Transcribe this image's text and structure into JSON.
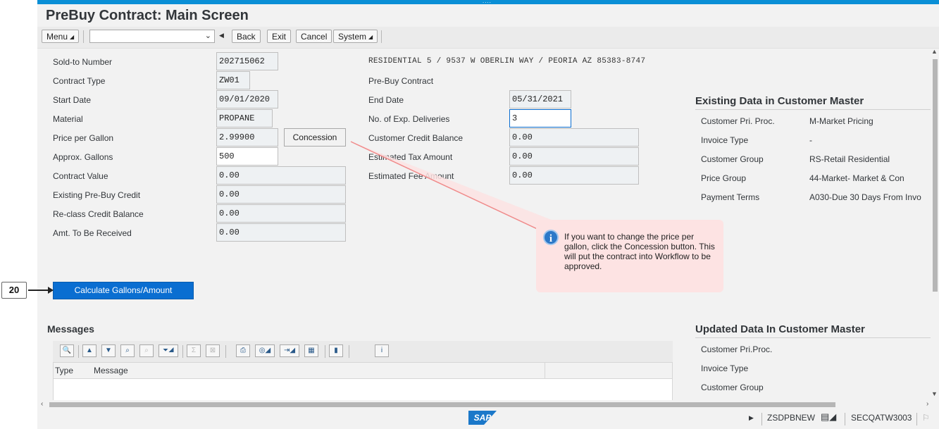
{
  "window": {
    "title": "PreBuy Contract: Main Screen"
  },
  "toolbar": {
    "menu_label": "Menu",
    "back_label": "Back",
    "exit_label": "Exit",
    "cancel_label": "Cancel",
    "system_label": "System"
  },
  "header_address": "RESIDENTIAL 5 / 9537 W OBERLIN WAY / PEORIA AZ 85383-8747",
  "left_fields": [
    {
      "label": "Sold-to Number",
      "value": "202715062"
    },
    {
      "label": "Contract Type",
      "value": "ZW01"
    },
    {
      "label": "Start Date",
      "value": "09/01/2020"
    },
    {
      "label": "Material",
      "value": "PROPANE"
    },
    {
      "label": "Price per Gallon",
      "value": "2.99900"
    },
    {
      "label": "Approx. Gallons",
      "value": "500"
    },
    {
      "label": "Contract Value",
      "value": "0.00"
    },
    {
      "label": "Existing Pre-Buy Credit",
      "value": "0.00"
    },
    {
      "label": "Re-class Credit Balance",
      "value": "0.00"
    },
    {
      "label": "Amt. To Be Received",
      "value": "0.00"
    }
  ],
  "concession_label": "Concession",
  "middle": {
    "contract_kind": "Pre-Buy Contract",
    "fields": [
      {
        "label": "End Date",
        "value": "05/31/2021"
      },
      {
        "label": "No. of Exp. Deliveries",
        "value": "3"
      },
      {
        "label": "Customer Credit Balance",
        "value": "0.00"
      },
      {
        "label": "Estimated Tax Amount",
        "value": "0.00"
      },
      {
        "label": "Estimated Fee Amount",
        "value": "0.00"
      }
    ]
  },
  "existing_master": {
    "heading": "Existing Data in Customer Master",
    "rows": [
      {
        "label": "Customer Pri. Proc.",
        "value": "M-Market Pricing"
      },
      {
        "label": "Invoice Type",
        "value": "-"
      },
      {
        "label": "Customer Group",
        "value": "RS-Retail Residential"
      },
      {
        "label": "Price Group",
        "value": "44-Market- Market & Con"
      },
      {
        "label": "Payment Terms",
        "value": "A030-Due 30 Days From Invo"
      }
    ]
  },
  "updated_master": {
    "heading": "Updated Data In Customer Master",
    "rows": [
      {
        "label": "Customer Pri.Proc."
      },
      {
        "label": "Invoice Type"
      },
      {
        "label": "Customer Group"
      }
    ]
  },
  "callout_text": "If you want to change the price per gallon, click the Concession button. This will put the contract into Workflow to be approved.",
  "calculate_label": "Calculate Gallons/Amount",
  "step_badge": "20",
  "messages": {
    "heading": "Messages",
    "columns": [
      "Type",
      "Message"
    ]
  },
  "status_bar": {
    "transaction": "ZSDPBNEW",
    "system": "SECQATW3003",
    "logo": "SAP"
  },
  "colors": {
    "accent": "#0a6ed1",
    "topbar": "#0a8fd6",
    "callout": "#fde3e3"
  }
}
